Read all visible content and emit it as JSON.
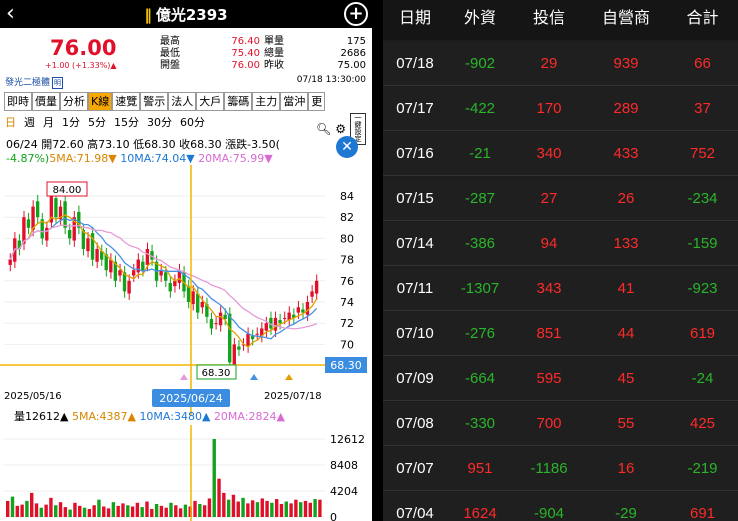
{
  "header": {
    "back_icon": "back-icon",
    "title": "億光2393",
    "add_icon": "add-icon"
  },
  "quote": {
    "price": "76.00",
    "change": "+1.00 (+1.33%)▲",
    "rows": [
      {
        "l1": "最高",
        "v1": "76.40",
        "l2": "單量",
        "v2": "175"
      },
      {
        "l1": "最低",
        "v1": "75.40",
        "l2": "總量",
        "v2": "2686"
      },
      {
        "l1": "開盤",
        "v1": "76.00",
        "l2": "昨收",
        "v2": "75.00"
      }
    ]
  },
  "broker": {
    "name": "發光二極體",
    "icon": "明",
    "time": "07/18 13:30:00"
  },
  "tabs": [
    "即時",
    "價量",
    "分析",
    "K線",
    "速覽",
    "警示",
    "法人",
    "大戶",
    "籌碼",
    "主力",
    "當沖",
    "更"
  ],
  "active_tab": "K線",
  "periods": [
    "日",
    "週",
    "月",
    "1分",
    "5分",
    "15分",
    "30分",
    "60分"
  ],
  "active_period": "日",
  "tools": {
    "search_icon": "search-icon",
    "settings_icon": "gear-icon",
    "box_label": "一鍵設定"
  },
  "candle_info": {
    "line1": "06/24 開72.60 高73.10 低68.30 收68.30 漲跌-3.50(",
    "line2_a": "-4.87%)",
    "ma5": "5MA:71.98▼",
    "ma10": "10MA:74.04▼",
    "ma20": "20MA:75.99▼"
  },
  "price_chart": {
    "y_ticks": [
      "84",
      "82",
      "80",
      "78",
      "76",
      "74",
      "72",
      "70"
    ],
    "max_label": "84.00",
    "min_label": "68.30",
    "current_price_tag": "68.30",
    "x_labels": [
      "2025/05/16",
      "2025/06/24",
      "2025/07/18"
    ]
  },
  "volume_info": {
    "vol": "量12612▲",
    "ma5": "5MA:4387▲",
    "ma10": "10MA:3480▲",
    "ma20": "20MA:2824▲"
  },
  "volume_chart": {
    "y_ticks": [
      "12612",
      "8408",
      "4204",
      "0"
    ]
  },
  "colors": {
    "up": "#e0102b",
    "down": "#13a21b",
    "accent": "#f7a800",
    "blue": "#1f77d4"
  },
  "table": {
    "headers": [
      "日期",
      "外資",
      "投信",
      "自營商",
      "合計"
    ],
    "rows": [
      [
        "07/18",
        "-902",
        "29",
        "939",
        "66"
      ],
      [
        "07/17",
        "-422",
        "170",
        "289",
        "37"
      ],
      [
        "07/16",
        "-21",
        "340",
        "433",
        "752"
      ],
      [
        "07/15",
        "-287",
        "27",
        "26",
        "-234"
      ],
      [
        "07/14",
        "-386",
        "94",
        "133",
        "-159"
      ],
      [
        "07/11",
        "-1307",
        "343",
        "41",
        "-923"
      ],
      [
        "07/10",
        "-276",
        "851",
        "44",
        "619"
      ],
      [
        "07/09",
        "-664",
        "595",
        "45",
        "-24"
      ],
      [
        "07/08",
        "-330",
        "700",
        "55",
        "425"
      ],
      [
        "07/07",
        "951",
        "-1186",
        "16",
        "-219"
      ],
      [
        "07/04",
        "1624",
        "-904",
        "-29",
        "691"
      ]
    ]
  }
}
